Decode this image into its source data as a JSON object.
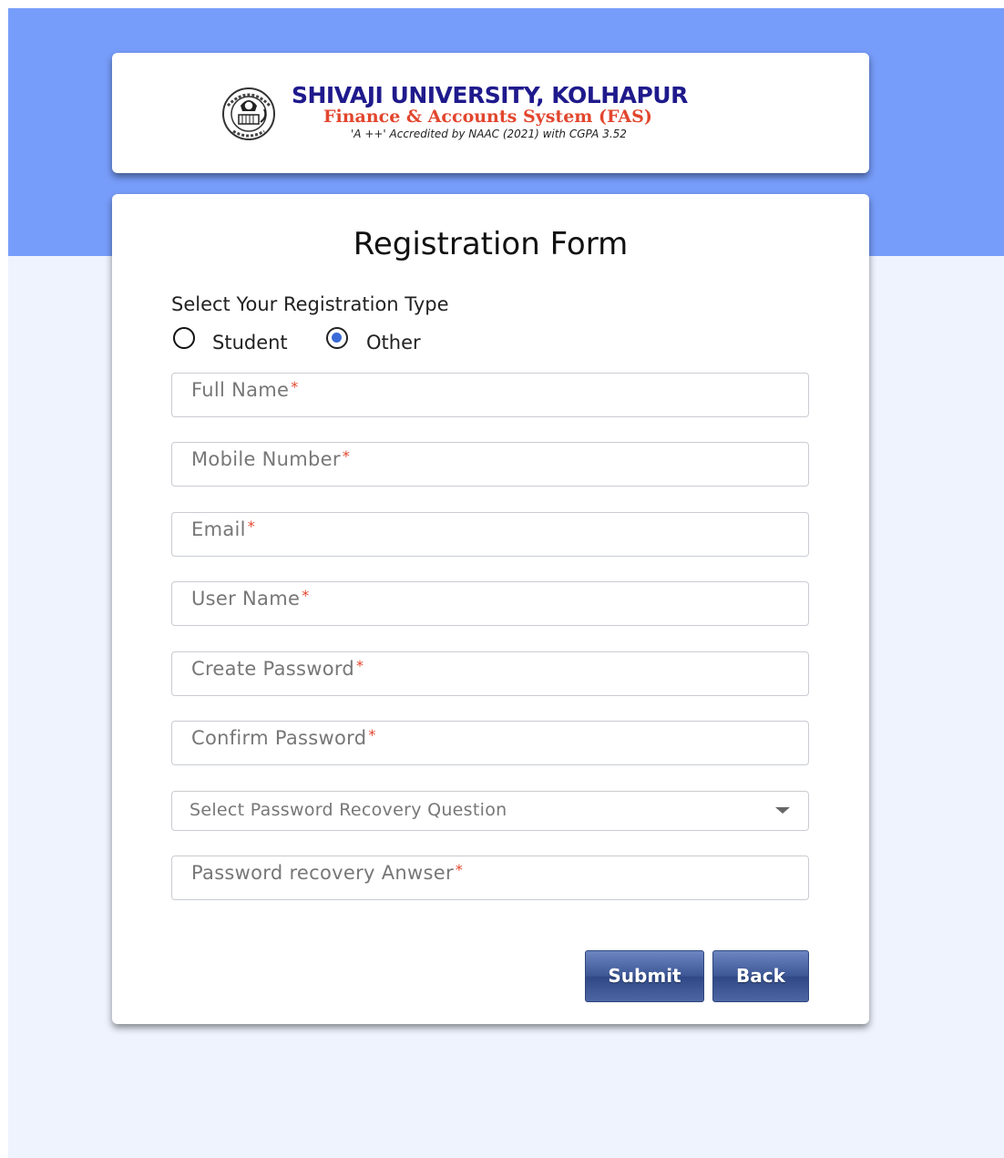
{
  "header": {
    "university_name": "SHIVAJI UNIVERSITY, KOLHAPUR",
    "system_name": "Finance & Accounts System (FAS)",
    "accreditation": "'A ++' Accredited by NAAC (2021) with CGPA 3.52"
  },
  "form": {
    "title": "Registration Form",
    "registration_type_label": "Select Your Registration Type",
    "registration_types": [
      {
        "label": "Student",
        "checked": false
      },
      {
        "label": "Other",
        "checked": true
      }
    ],
    "fields": {
      "full_name": {
        "placeholder": "Full Name",
        "value": ""
      },
      "mobile_number": {
        "placeholder": "Mobile Number",
        "value": ""
      },
      "email": {
        "placeholder": "Email",
        "value": ""
      },
      "user_name": {
        "placeholder": "User Name",
        "value": ""
      },
      "create_password": {
        "placeholder": "Create Password",
        "value": ""
      },
      "confirm_password": {
        "placeholder": "Confirm Password",
        "value": ""
      },
      "recovery_question": {
        "selected": "Select Password Recovery Question"
      },
      "recovery_answer": {
        "placeholder": "Password recovery Anwser",
        "value": ""
      }
    },
    "required_marker": "*",
    "submit_label": "Submit",
    "back_label": "Back"
  },
  "colors": {
    "top_band": "#779dfa",
    "page_background": "#eef3fe",
    "title_navy": "#1f1a8c",
    "accent_red": "#e2462e",
    "button_blue": "#3c5695"
  }
}
